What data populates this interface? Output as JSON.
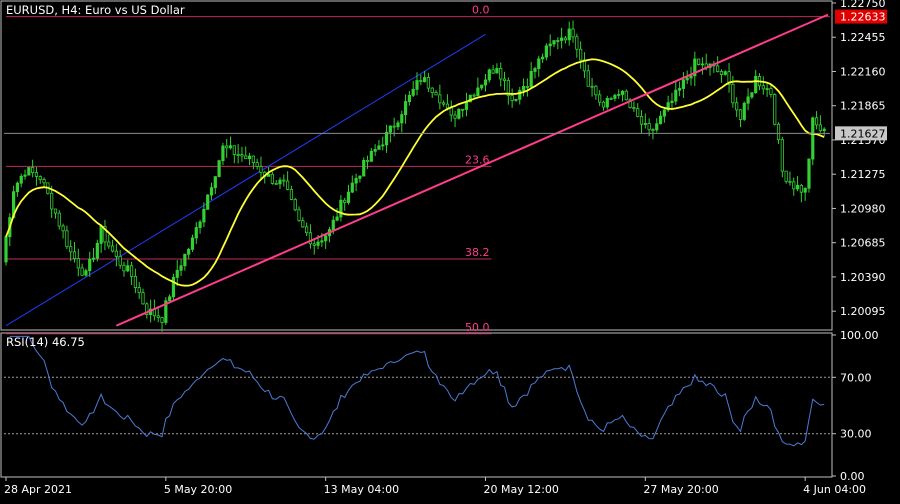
{
  "colors": {
    "background": "#000000",
    "panel_border": "#c0c0c0",
    "text": "#ffffff",
    "bull": "#33d033",
    "bear": "#33d033",
    "ma": "#ffff33",
    "trendline": "#ff3d8b",
    "channel": "#1f3cff",
    "fib": "#c0285a",
    "fib_text": "#ff3d8b",
    "rsi": "#4b7bd8",
    "rsi_level": "#a0a0a0",
    "price_line": "#8c8c8c",
    "badge_red": "#e00000"
  },
  "chart_data": [
    {
      "type": "candlestick",
      "title": "EURUSD, H4:  Euro vs US Dollar",
      "ylim": [
        1.1995,
        1.2275
      ],
      "y_ticks": [
        "1.22750",
        "1.22455",
        "1.22160",
        "1.21865",
        "1.21570",
        "1.21275",
        "1.20980",
        "1.20685",
        "1.20390",
        "1.20095"
      ],
      "y_tick_values": [
        1.2275,
        1.22455,
        1.2216,
        1.21865,
        1.2157,
        1.21275,
        1.2098,
        1.20685,
        1.2039,
        1.20095
      ],
      "x_ticks": [
        "28 Apr 2021",
        "5 May 20:00",
        "13 May 04:00",
        "20 May 12:00",
        "27 May 20:00",
        "4 Jun 04:00"
      ],
      "x_tick_bars": [
        0,
        42,
        84,
        126,
        168,
        210
      ],
      "bar_count": 216,
      "current_price": "1.21627",
      "current_price_value": 1.21627,
      "high_price": "1.22633",
      "high_price_value": 1.22633,
      "price_anchors": [
        [
          0,
          1.2052
        ],
        [
          3,
          1.2115
        ],
        [
          6,
          1.2131
        ],
        [
          10,
          1.2125
        ],
        [
          14,
          1.2094
        ],
        [
          18,
          1.206
        ],
        [
          22,
          1.204
        ],
        [
          26,
          1.2078
        ],
        [
          30,
          1.2055
        ],
        [
          34,
          1.204
        ],
        [
          38,
          1.201
        ],
        [
          42,
          1.2004
        ],
        [
          46,
          1.2045
        ],
        [
          50,
          1.207
        ],
        [
          54,
          1.211
        ],
        [
          58,
          1.215
        ],
        [
          62,
          1.2145
        ],
        [
          66,
          1.2138
        ],
        [
          70,
          1.2125
        ],
        [
          74,
          1.2118
        ],
        [
          78,
          1.2085
        ],
        [
          82,
          1.2068
        ],
        [
          86,
          1.2078
        ],
        [
          90,
          1.2108
        ],
        [
          94,
          1.213
        ],
        [
          98,
          1.2148
        ],
        [
          102,
          1.2165
        ],
        [
          106,
          1.2188
        ],
        [
          110,
          1.221
        ],
        [
          114,
          1.22
        ],
        [
          118,
          1.2175
        ],
        [
          122,
          1.2192
        ],
        [
          126,
          1.2207
        ],
        [
          130,
          1.2222
        ],
        [
          134,
          1.2192
        ],
        [
          138,
          1.2208
        ],
        [
          142,
          1.223
        ],
        [
          146,
          1.2245
        ],
        [
          150,
          1.225
        ],
        [
          154,
          1.2208
        ],
        [
          158,
          1.2185
        ],
        [
          162,
          1.22
        ],
        [
          166,
          1.218
        ],
        [
          170,
          1.2162
        ],
        [
          174,
          1.218
        ],
        [
          178,
          1.22
        ],
        [
          182,
          1.2222
        ],
        [
          186,
          1.222
        ],
        [
          190,
          1.2212
        ],
        [
          194,
          1.2175
        ],
        [
          198,
          1.221
        ],
        [
          202,
          1.2198
        ],
        [
          205,
          1.213
        ],
        [
          208,
          1.2118
        ],
        [
          211,
          1.2113
        ],
        [
          213,
          1.2172
        ],
        [
          216,
          1.2163
        ]
      ],
      "fibonacci": [
        {
          "level": "0.0",
          "price": 1.22633
        },
        {
          "level": "23.6",
          "price": 1.21343
        },
        {
          "level": "38.2",
          "price": 1.20545
        },
        {
          "level": "50.0",
          "price": 1.199
        }
      ],
      "fib_start_bar": 0,
      "fib_end_bar": 126,
      "trendline": {
        "start": [
          29,
          1.1997
        ],
        "end": [
          216,
          1.2265
        ]
      },
      "channel_line": {
        "start": [
          0,
          1.1997
        ],
        "end": [
          126,
          1.2248
        ]
      },
      "moving_average": {
        "period": 20
      }
    },
    {
      "type": "line",
      "title": "RSI(14) 46.75",
      "ylim": [
        0,
        100
      ],
      "y_ticks": [
        "100.00",
        "70.00",
        "30.00",
        "0.00"
      ],
      "y_tick_values": [
        100,
        70,
        30,
        0
      ],
      "levels": [
        70,
        30
      ],
      "value": 46.75
    }
  ]
}
